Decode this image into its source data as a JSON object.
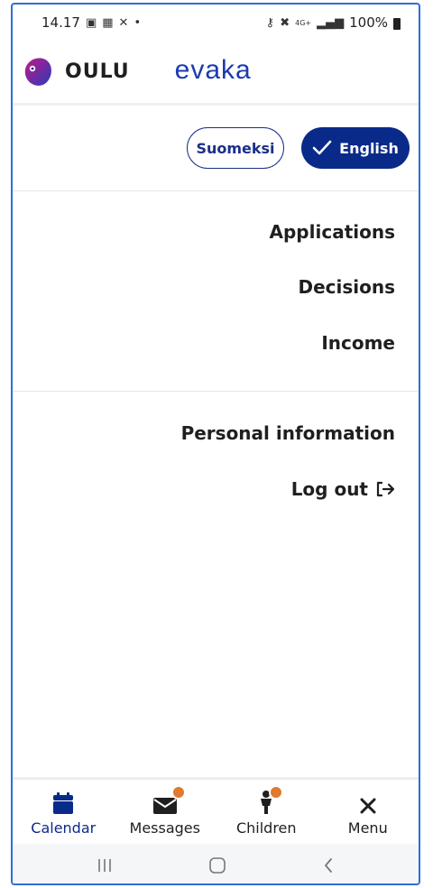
{
  "status_bar": {
    "time": "14.17",
    "battery": "100%",
    "network": "4G+"
  },
  "header": {
    "municipality": "OULU",
    "app_name": "evaka"
  },
  "language": {
    "finnish_label": "Suomeksi",
    "english_label": "English",
    "selected": "English"
  },
  "menu": {
    "items": [
      {
        "label": "Applications"
      },
      {
        "label": "Decisions"
      },
      {
        "label": "Income"
      }
    ],
    "account_items": [
      {
        "label": "Personal information"
      },
      {
        "label": "Log out"
      }
    ]
  },
  "bottom_nav": {
    "items": [
      {
        "label": "Calendar",
        "icon": "calendar-icon",
        "active": true
      },
      {
        "label": "Messages",
        "icon": "envelope-icon",
        "badge": true
      },
      {
        "label": "Children",
        "icon": "child-icon",
        "badge": true
      },
      {
        "label": "Menu",
        "icon": "close-icon"
      }
    ]
  },
  "colors": {
    "primary": "#0a2a8a",
    "brand_text": "#1a3bb0",
    "badge": "#e07a2e"
  }
}
